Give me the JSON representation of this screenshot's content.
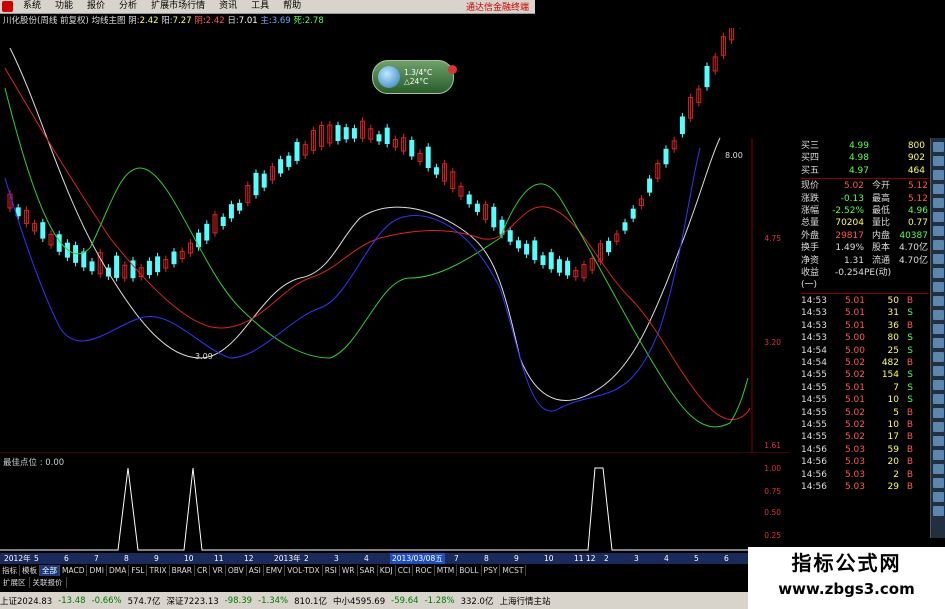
{
  "menubar": {
    "items": [
      "系统",
      "功能",
      "报价",
      "分析",
      "扩展市场行情",
      "资讯",
      "工具",
      "帮助"
    ],
    "broker": "通达信金融终端"
  },
  "title": {
    "name": "川化股份(周线 前复权) 均线主图",
    "open_label": "阴",
    "open": "2.42",
    "high_label": "阳",
    "high": "7.27",
    "low_label": "阴",
    "low": "2.42",
    "close_label": "日",
    "close": "7.01",
    "vol_label": "主",
    "vol": "3.69",
    "end_label": "死",
    "end": "2.78"
  },
  "weather": {
    "line1": "1.3/4°C",
    "line2": "△24°C"
  },
  "price_chart": {
    "low_marker": "3.09",
    "high_marker": "8.00",
    "axis": [
      "4.75",
      "3.20",
      "1.61"
    ]
  },
  "indicator": {
    "label": "最佳点位 : 0.00",
    "axis": [
      "1.00",
      "0.75",
      "0.50",
      "0.25"
    ]
  },
  "order_book": [
    {
      "label": "买三",
      "price": "4.99",
      "vol": "800"
    },
    {
      "label": "买四",
      "price": "4.98",
      "vol": "902"
    },
    {
      "label": "买五",
      "price": "4.97",
      "vol": "464"
    }
  ],
  "quote": [
    {
      "l1": "现价",
      "v1": "5.02",
      "c1": "#ff5555",
      "l2": "今开",
      "v2": "5.12",
      "c2": "#ff5555"
    },
    {
      "l1": "涨跌",
      "v1": "-0.13",
      "c1": "#55ff55",
      "l2": "最高",
      "v2": "5.12",
      "c2": "#ff5555"
    },
    {
      "l1": "涨幅",
      "v1": "-2.52%",
      "c1": "#55ff55",
      "l2": "最低",
      "v2": "4.96",
      "c2": "#55ff55"
    },
    {
      "l1": "总量",
      "v1": "70204",
      "c1": "#ffff55",
      "l2": "量比",
      "v2": "0.77",
      "c2": "#ffff55"
    },
    {
      "l1": "外盘",
      "v1": "29817",
      "c1": "#ff5555",
      "l2": "内盘",
      "v2": "40387",
      "c2": "#55ff55"
    },
    {
      "l1": "换手",
      "v1": "1.49%",
      "c1": "#dddddd",
      "l2": "股本",
      "v2": "4.70亿",
      "c2": "#dddddd"
    },
    {
      "l1": "净资",
      "v1": "1.31",
      "c1": "#dddddd",
      "l2": "流通",
      "v2": "4.70亿",
      "c2": "#dddddd"
    },
    {
      "l1": "收益(一)",
      "v1": "-0.254",
      "c1": "#dddddd",
      "l2": "PE(动)",
      "v2": "",
      "c2": "#dddddd"
    }
  ],
  "ticks": [
    {
      "t": "14:53",
      "p": "5.01",
      "v": "50",
      "d": "B"
    },
    {
      "t": "14:53",
      "p": "5.01",
      "v": "31",
      "d": "S"
    },
    {
      "t": "14:53",
      "p": "5.01",
      "v": "36",
      "d": "B"
    },
    {
      "t": "14:53",
      "p": "5.00",
      "v": "80",
      "d": "S"
    },
    {
      "t": "14:54",
      "p": "5.00",
      "v": "25",
      "d": "S"
    },
    {
      "t": "14:54",
      "p": "5.02",
      "v": "482",
      "d": "B"
    },
    {
      "t": "14:55",
      "p": "5.02",
      "v": "154",
      "d": "S"
    },
    {
      "t": "14:55",
      "p": "5.01",
      "v": "7",
      "d": "S"
    },
    {
      "t": "14:55",
      "p": "5.01",
      "v": "10",
      "d": "S"
    },
    {
      "t": "14:55",
      "p": "5.02",
      "v": "5",
      "d": "B"
    },
    {
      "t": "14:55",
      "p": "5.02",
      "v": "10",
      "d": "B"
    },
    {
      "t": "14:55",
      "p": "5.02",
      "v": "17",
      "d": "B"
    },
    {
      "t": "14:56",
      "p": "5.03",
      "v": "59",
      "d": "B"
    },
    {
      "t": "14:56",
      "p": "5.03",
      "v": "20",
      "d": "B"
    },
    {
      "t": "14:56",
      "p": "5.03",
      "v": "2",
      "d": "B"
    },
    {
      "t": "14:56",
      "p": "5.03",
      "v": "29",
      "d": "B"
    }
  ],
  "date_axis": {
    "items": [
      "2012年",
      "5",
      "6",
      "7",
      "8",
      "9",
      "10",
      "11",
      "12",
      "2013年",
      "2",
      "3",
      "4",
      "5",
      "6",
      "7",
      "8",
      "9",
      "10",
      "11 12",
      "2",
      "3",
      "4",
      "5",
      "6"
    ],
    "highlight": "2013/03/08五"
  },
  "tabs": [
    "指标",
    "模板",
    "全部",
    "MACD",
    "DMI",
    "DMA",
    "FSL",
    "TRIX",
    "BRAR",
    "CR",
    "VR",
    "OBV",
    "ASI",
    "EMV",
    "VOL-TDX",
    "RSI",
    "WR",
    "SAR",
    "KDJ",
    "CCI",
    "ROC",
    "MTM",
    "BOLL",
    "PSY",
    "MCST"
  ],
  "subtabs": [
    "扩展区",
    "关联报价"
  ],
  "status": [
    {
      "text": "上证2024.83",
      "cls": ""
    },
    {
      "text": "-13.48",
      "cls": "dn"
    },
    {
      "text": "-0.66%",
      "cls": "dn"
    },
    {
      "text": "574.7亿",
      "cls": ""
    },
    {
      "text": "深证7223.13",
      "cls": ""
    },
    {
      "text": "-98.39",
      "cls": "dn"
    },
    {
      "text": "-1.34%",
      "cls": "dn"
    },
    {
      "text": "810.1亿",
      "cls": ""
    },
    {
      "text": "中小4595.69",
      "cls": ""
    },
    {
      "text": "-59.64",
      "cls": "dn"
    },
    {
      "text": "-1.28%",
      "cls": "dn"
    },
    {
      "text": "332.0亿",
      "cls": ""
    },
    {
      "text": "上海行情主站",
      "cls": ""
    }
  ],
  "watermark": {
    "line1": "指标公式网",
    "line2": "www.zbgs3.com"
  }
}
